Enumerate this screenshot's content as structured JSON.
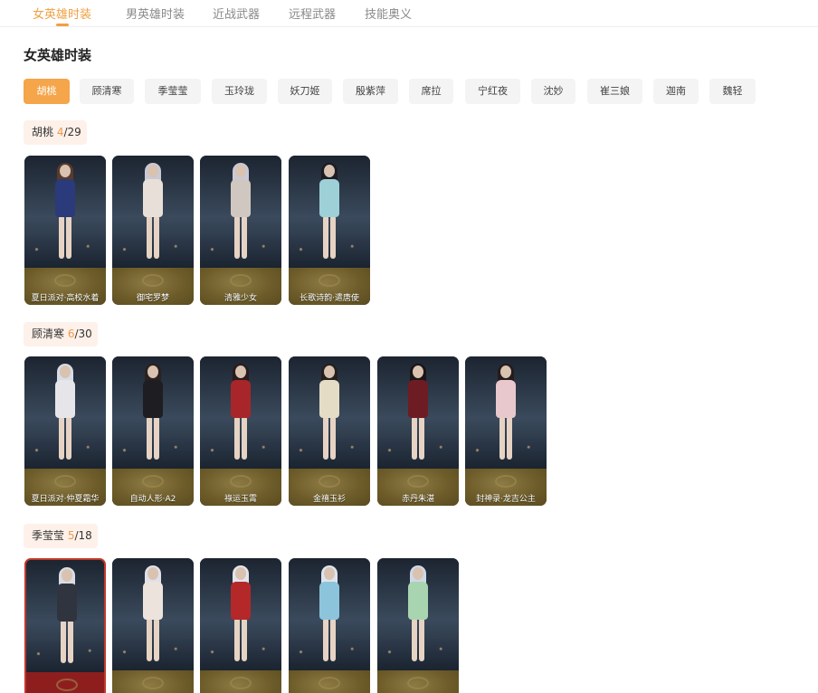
{
  "tabs": [
    {
      "label": "女英雄时装",
      "active": true
    },
    {
      "label": "男英雄时装",
      "active": false
    },
    {
      "label": "近战武器",
      "active": false
    },
    {
      "label": "远程武器",
      "active": false
    },
    {
      "label": "技能奥义",
      "active": false
    }
  ],
  "section_title": "女英雄时装",
  "hero_chips": [
    {
      "label": "胡桃",
      "active": true
    },
    {
      "label": "顾清寒",
      "active": false
    },
    {
      "label": "季莹莹",
      "active": false
    },
    {
      "label": "玉玲珑",
      "active": false
    },
    {
      "label": "妖刀姬",
      "active": false
    },
    {
      "label": "殷紫萍",
      "active": false
    },
    {
      "label": "席拉",
      "active": false
    },
    {
      "label": "宁红夜",
      "active": false
    },
    {
      "label": "沈妙",
      "active": false
    },
    {
      "label": "崔三娘",
      "active": false
    },
    {
      "label": "迦南",
      "active": false
    },
    {
      "label": "魏轻",
      "active": false
    }
  ],
  "groups": [
    {
      "hero": "胡桃",
      "owned": "4",
      "total": "/29",
      "skins": [
        {
          "name": "夏日派对·高校水着",
          "outfit": "#2a3a7a",
          "hair": "#5a3a2a"
        },
        {
          "name": "御宅罗梦",
          "outfit": "#e8e0d8",
          "hair": "#c9c9d6"
        },
        {
          "name": "清雅少女",
          "outfit": "#cfc7c0",
          "hair": "#c8c8d8"
        },
        {
          "name": "长歌诗韵·遣唐使",
          "outfit": "#9ed0d8",
          "hair": "#1c1c24"
        }
      ]
    },
    {
      "hero": "顾清寒",
      "owned": "6",
      "total": "/30",
      "skins": [
        {
          "name": "夏日派对·仲夏霜华",
          "outfit": "#e6e6ea",
          "hair": "#d6dde6"
        },
        {
          "name": "自动人形·A2",
          "outfit": "#1e1e22",
          "hair": "#2a2220"
        },
        {
          "name": "祿运玉霄",
          "outfit": "#a8262a",
          "hair": "#2a1c1c"
        },
        {
          "name": "金禧玉衫",
          "outfit": "#e4dcc4",
          "hair": "#24201c"
        },
        {
          "name": "赤丹朱湛",
          "outfit": "#6e1c24",
          "hair": "#1c1418"
        },
        {
          "name": "封神录·龙吉公主",
          "outfit": "#e8c8cc",
          "hair": "#241c1c"
        }
      ]
    },
    {
      "hero": "季莹莹",
      "owned": "5",
      "total": "/18",
      "skins": [
        {
          "name": "",
          "outfit": "#30343e",
          "hair": "#d8dce4",
          "selected": true
        },
        {
          "name": "",
          "outfit": "#ece4dc",
          "hair": "#e0e0e8"
        },
        {
          "name": "",
          "outfit": "#b4282a",
          "hair": "#e4e4ea"
        },
        {
          "name": "",
          "outfit": "#8cc4dc",
          "hair": "#dde4ee"
        },
        {
          "name": "",
          "outfit": "#a8d4b0",
          "hair": "#cfd8e6"
        }
      ]
    }
  ]
}
